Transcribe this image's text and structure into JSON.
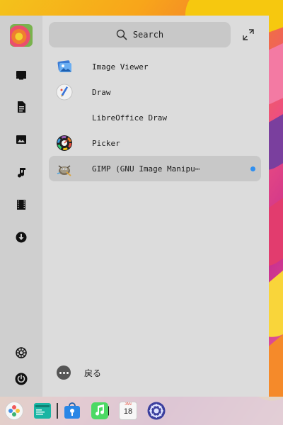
{
  "search": {
    "placeholder": "Search"
  },
  "apps": [
    {
      "label": "Image Viewer",
      "icon": "image-viewer-icon"
    },
    {
      "label": "Draw",
      "icon": "draw-icon"
    },
    {
      "label": "LibreOffice Draw",
      "icon": "none"
    },
    {
      "label": "Picker",
      "icon": "color-picker-icon"
    },
    {
      "label": "GIMP (GNU Image Manipu⋯",
      "icon": "gimp-icon",
      "selected": true,
      "new": true
    }
  ],
  "back": {
    "label": "戻る"
  },
  "sidebar": {
    "categories": [
      "computer-icon",
      "document-icon",
      "picture-icon",
      "music-icon",
      "video-icon",
      "download-icon"
    ],
    "bottom": [
      "settings-icon",
      "power-icon"
    ]
  },
  "dock": {
    "items": [
      "launcher-icon",
      "file-manager-icon",
      "app-store-icon",
      "music-player-icon",
      "calendar-icon",
      "system-settings-icon"
    ],
    "calendar": {
      "month": "JAN",
      "day": "18"
    }
  },
  "colors": {
    "accent": "#2f8ff0",
    "selected_bg": "#c8c8c8",
    "panel_bg": "#dcdcdc",
    "rail_bg": "#cfcfcf"
  }
}
